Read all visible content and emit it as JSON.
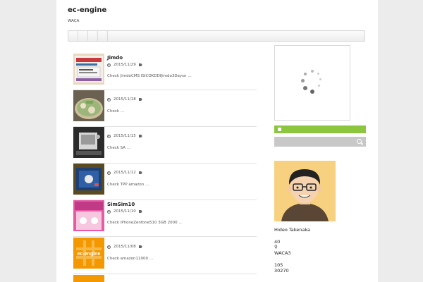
{
  "site": {
    "title": "ec-engine",
    "tagline": "WACA"
  },
  "nav": {
    "items": [
      "",
      "",
      "",
      ""
    ]
  },
  "posts": [
    {
      "title": "Jimdo",
      "date": "2015/11/29",
      "excerpt": "Check JimdoCMS ISICOKDDIJimdo3Daysn …",
      "thumb": "jimdo-screenshot"
    },
    {
      "title": "",
      "date": "2015/11/18",
      "excerpt": "Check     …",
      "thumb": "food-bowl"
    },
    {
      "title": "",
      "date": "2015/11/15",
      "excerpt": "Check  SA   …",
      "thumb": "desk-device"
    },
    {
      "title": "",
      "date": "2015/11/12",
      "excerpt": "Check TPP  amazon   …",
      "thumb": "blue-device"
    },
    {
      "title": "SimSim10",
      "date": "2015/11/10",
      "excerpt": "Check iPhoneZenfone510 3GB 2000 …",
      "thumb": "pink-package"
    },
    {
      "title": "",
      "date": "2015/11/08",
      "excerpt": "Check amazon11000    …",
      "thumb": "ec-engine-logo"
    }
  ],
  "logo_text": "ec-engine",
  "sidebar": {
    "profile": {
      "name": "Hideo Takenaka",
      "lines": [
        "40",
        "♀",
        "WACA3",
        "",
        "105",
        "30270"
      ]
    }
  },
  "colors": {
    "accent_green": "#8cc63f",
    "search_bar": "#c8c8c8",
    "logo_orange": "#f39800"
  }
}
